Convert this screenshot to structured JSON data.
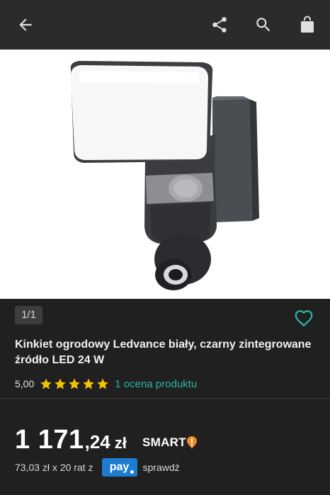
{
  "header": {
    "back_icon": "arrow-left-icon",
    "share_icon": "share-icon",
    "search_icon": "search-icon",
    "cart_icon": "shopping-bag-icon"
  },
  "gallery": {
    "counter": "1/1",
    "favorite_icon": "heart-icon"
  },
  "product": {
    "title": "Kinkiet ogrodowy Ledvance biały, czarny zintegrowane źródło LED 24 W",
    "rating_value": "5,00",
    "stars": 5,
    "reviews_link": "1 ocena produktu"
  },
  "price": {
    "main": "1 171",
    "fraction": ",24",
    "currency": "zł",
    "smart_label": "SMART",
    "smart_icon": "exclamation-badge-icon"
  },
  "installments": {
    "text": "73,03 zł x 20 rat z",
    "pay_label": "pay",
    "check_link": "sprawdź"
  },
  "colors": {
    "accent": "#2cb6a0",
    "star": "#f5c400",
    "smart_orange": "#f08a24",
    "pay_blue": "#1e7cd0"
  }
}
